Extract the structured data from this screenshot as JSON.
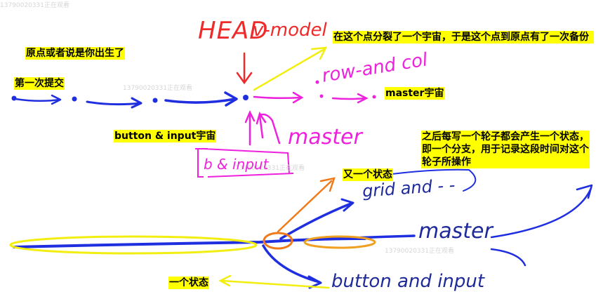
{
  "watermark": "13790020331正在观看",
  "labels": {
    "origin": "原点或者说是你出生了",
    "first_commit": "第一次提交",
    "split": "在这个点分裂了一个宇宙，于是这个点到原点有了一次备份",
    "master_universe": "master宇宙",
    "button_universe": "button & input宇宙",
    "each_wheel": "之后每写一个轮子都会产生一个状态，即一个分支，用于记录这段时间对这个轮子所操作",
    "another_state": "又一个状态",
    "one_state": "一个状态"
  },
  "handwriting": {
    "head": "HEAD",
    "v_model": "v-model",
    "row_and_col": "row-and col",
    "master_top": "master",
    "b_and_input": "b & input",
    "grid_and": "grid and - -",
    "master_bottom": "master",
    "button_and_input": "button and input"
  },
  "colors": {
    "blue_ink": "#1f2fe0",
    "magenta_ink": "#ee22dd",
    "red_ink": "#ee2a2a",
    "yellow_ink": "#f2ee10",
    "orange_ink": "#f07a1a",
    "navy_text": "#1f2a9a",
    "highlight": "#ffff00"
  }
}
